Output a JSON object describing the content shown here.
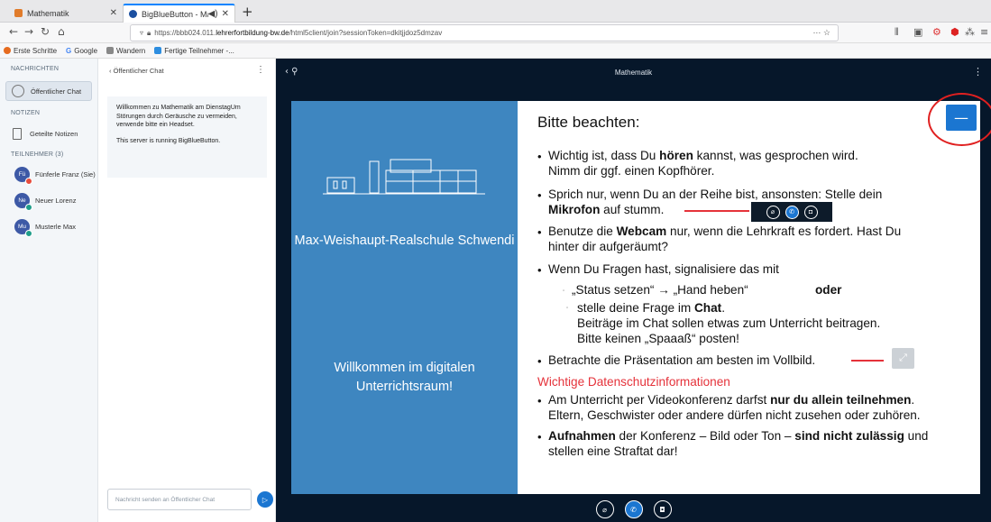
{
  "browser": {
    "tabs": [
      {
        "label": "Mathematik"
      },
      {
        "label": "BigBlueButton - Mathema"
      }
    ],
    "new_tab_symbol": "+",
    "url_prefix": "https://bbb024.011.",
    "url_host": "lehrerfortbildung-bw.de",
    "url_rest": "/html5client/join?sessionToken=dkitjjdoz5dmzav",
    "url_actions": "···  ☆",
    "bookmarks": [
      {
        "label": "Erste Schritte",
        "icon": "firefox-icon"
      },
      {
        "label": "Google",
        "icon": "google-icon"
      },
      {
        "label": "Wandern",
        "icon": "folder-icon"
      },
      {
        "label": "Fertige Teilnehmer -...",
        "icon": "bookmark-icon"
      }
    ]
  },
  "sidebar": {
    "messages_heading": "NACHRICHTEN",
    "public_chat": "Öffentlicher Chat",
    "notes_heading": "NOTIZEN",
    "shared_notes": "Geteilte Notizen",
    "users_heading": "TEILNEHMER (3)",
    "users": [
      {
        "initials": "Fü",
        "name": "Fünferle Franz (Sie)",
        "status_color": "#e74c3c"
      },
      {
        "initials": "Ne",
        "name": "Neuer Lorenz",
        "status_color": "#1f9d8a"
      },
      {
        "initials": "Mu",
        "name": "Musterle Max",
        "status_color": "#1f9d8a"
      }
    ]
  },
  "chat": {
    "back_label": "‹  Öffentlicher Chat",
    "menu_symbol": "⋮",
    "welcome": "Willkommen zu Mathematik am DienstagUm Störungen durch Geräusche zu vermeiden, verwende bitte ein Headset.",
    "server_note": "This server is running BigBlueButton.",
    "input_placeholder": "Nachricht senden an Öffentlicher Chat",
    "send_symbol": "▷"
  },
  "stage": {
    "title": "Mathematik",
    "menu_symbol": "⋮",
    "minimize_symbol": "—",
    "slide": {
      "school_name": "Max-Weishaupt-Realschule Schwendi",
      "welcome": "Willkommen im digitalen Unterrichtsraum!",
      "heading": "Bitte beachten:",
      "b1_pre": "Wichtig ist, dass Du ",
      "b1_bold": "hören",
      "b1_post": " kannst, was gesprochen wird.",
      "b1_line2": "Nimm dir ggf. einen Kopfhörer.",
      "b2_line1": "Sprich nur, wenn Du an der Reihe bist, ansonsten: Stelle dein",
      "b2_bold": "Mikrofon",
      "b2_post": " auf stumm.",
      "b3_pre": "Benutze die ",
      "b3_bold": "Webcam",
      "b3_post": " nur, wenn die Lehrkraft es fordert. Hast Du",
      "b3_line2": "hinter dir aufgeräumt?",
      "b4": "Wenn Du Fragen hast, signalisiere das mit",
      "b4_sub1": "„Status setzen“ → „Hand heben“",
      "b4_sub1_or": "oder",
      "b4_sub2_pre": "stelle deine Frage im ",
      "b4_sub2_bold": "Chat",
      "b4_sub2_post": ".",
      "b4_sub2_line2": "Beiträge im Chat sollen etwas zum Unterricht beitragen.",
      "b4_sub2_line3": "Bitte keinen „Spaaaß“ posten!",
      "b5": "Betrachte die Präsentation am besten im Vollbild.",
      "privacy_heading": "Wichtige Datenschutzinformationen",
      "b6_pre": "Am Unterricht per Videokonferenz darfst ",
      "b6_bold": "nur du allein teilnehmen",
      "b6_post": ".",
      "b6_line2": "Eltern, Geschwister oder andere dürfen nicht zusehen oder zuhören.",
      "b7_bold1": "Aufnahmen",
      "b7_mid": " der Konferenz – Bild oder Ton – ",
      "b7_bold2": "sind nicht zulässig",
      "b7_post": " und",
      "b7_line2": "stellen eine Straftat dar!",
      "bullet": "•",
      "sub_bullet": "▫"
    }
  },
  "colors": {
    "accent": "#1b76d1",
    "slide_blue": "#3e86c0",
    "stage_bg": "#06172a",
    "highlight_red": "#e5323a"
  }
}
